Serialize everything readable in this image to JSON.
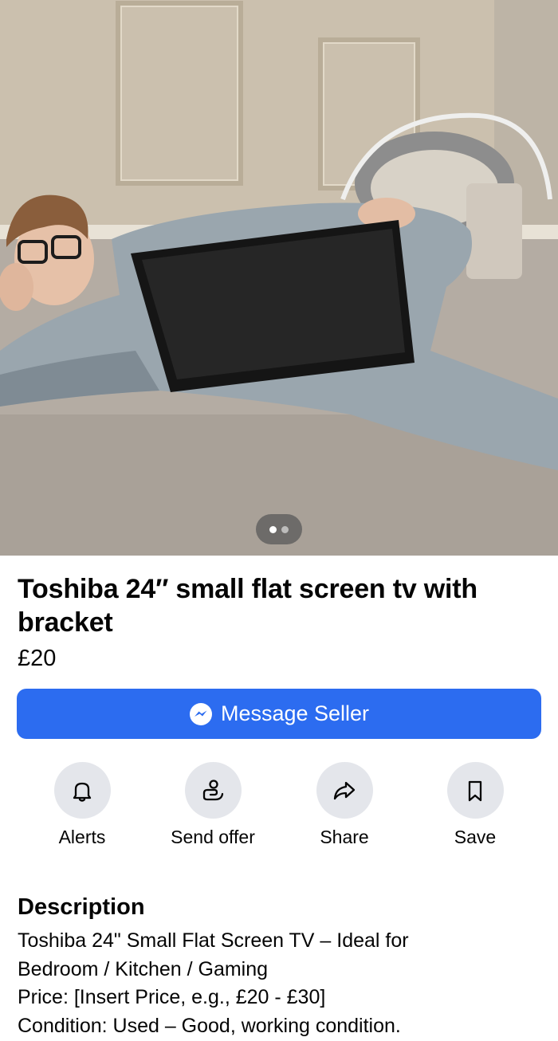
{
  "listing": {
    "photo_description_icon": "listing-photo",
    "carousel": {
      "total": 2,
      "current": 1
    },
    "title": "Toshiba 24″ small flat screen tv with bracket",
    "price": "£20"
  },
  "message_button": {
    "label": "Message Seller",
    "icon": "messenger-icon"
  },
  "actions": [
    {
      "label": "Alerts",
      "icon": "bell-icon"
    },
    {
      "label": "Send offer",
      "icon": "offer-hand-icon"
    },
    {
      "label": "Share",
      "icon": "share-arrow-icon"
    },
    {
      "label": "Save",
      "icon": "bookmark-icon"
    }
  ],
  "description": {
    "heading": "Description",
    "lines": [
      "Toshiba 24\" Small Flat Screen TV – Ideal for",
      "Bedroom / Kitchen / Gaming",
      "Price: [Insert Price, e.g., £20 - £30]",
      "Condition: Used – Good, working condition."
    ]
  },
  "colors": {
    "accent": "#2c6cf0",
    "action_circle": "#e4e6eb"
  }
}
